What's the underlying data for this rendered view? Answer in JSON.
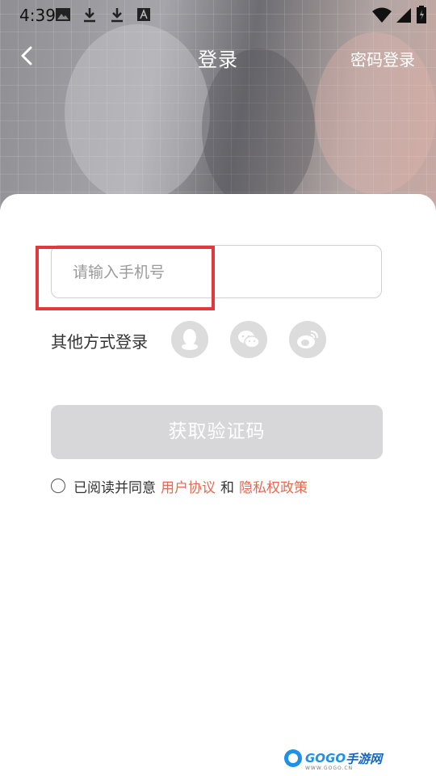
{
  "status_bar": {
    "time": "4:39"
  },
  "header": {
    "title": "登录",
    "password_login": "密码登录"
  },
  "phone": {
    "placeholder": "请输入手机号",
    "value": ""
  },
  "other_login": {
    "label": "其他方式登录",
    "methods": [
      "qq-icon",
      "wechat-icon",
      "weibo-icon"
    ]
  },
  "get_code_button": "获取验证码",
  "agreement": {
    "prefix": "已阅读并同意",
    "user_agreement": "用户协议",
    "and": "和",
    "privacy_policy": "隐私权政策",
    "checked": false
  },
  "watermark": {
    "brand": "GOGO",
    "brand_cn": "手游网",
    "url": "WWW.GOGO.CN"
  },
  "colors": {
    "accent_link": "#e26a52",
    "highlight_box": "#e0383c",
    "button_disabled": "#d7d7d9",
    "logo_blue": "#1e90e6"
  }
}
